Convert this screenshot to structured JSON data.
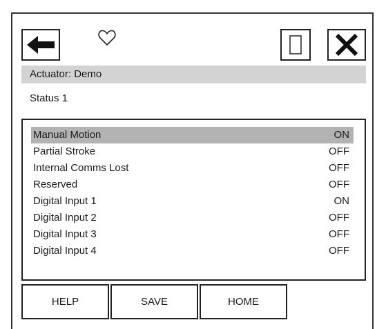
{
  "toolbar": {
    "back_icon": "arrow-left-icon",
    "favorite_icon": "heart-outline-icon",
    "window_icon": "window-rectangle-icon",
    "close_icon": "close-x-icon"
  },
  "header": {
    "title": "Actuator: Demo",
    "subtitle": "Status 1"
  },
  "status_list": {
    "rows": [
      {
        "label": "Manual Motion",
        "value": "ON"
      },
      {
        "label": "Partial Stroke",
        "value": "OFF"
      },
      {
        "label": "Internal Comms Lost",
        "value": "OFF"
      },
      {
        "label": "Reserved",
        "value": "OFF"
      },
      {
        "label": "Digital Input 1",
        "value": "ON"
      },
      {
        "label": "Digital Input 2",
        "value": "OFF"
      },
      {
        "label": "Digital Input 3",
        "value": "OFF"
      },
      {
        "label": "Digital Input 4",
        "value": "OFF"
      }
    ]
  },
  "footer": {
    "help_label": "HELP",
    "save_label": "SAVE",
    "home_label": "HOME"
  },
  "colors": {
    "titlebar_bg": "#d3d3d3",
    "selected_row_bg": "#b3b3b3",
    "border": "#222222"
  }
}
